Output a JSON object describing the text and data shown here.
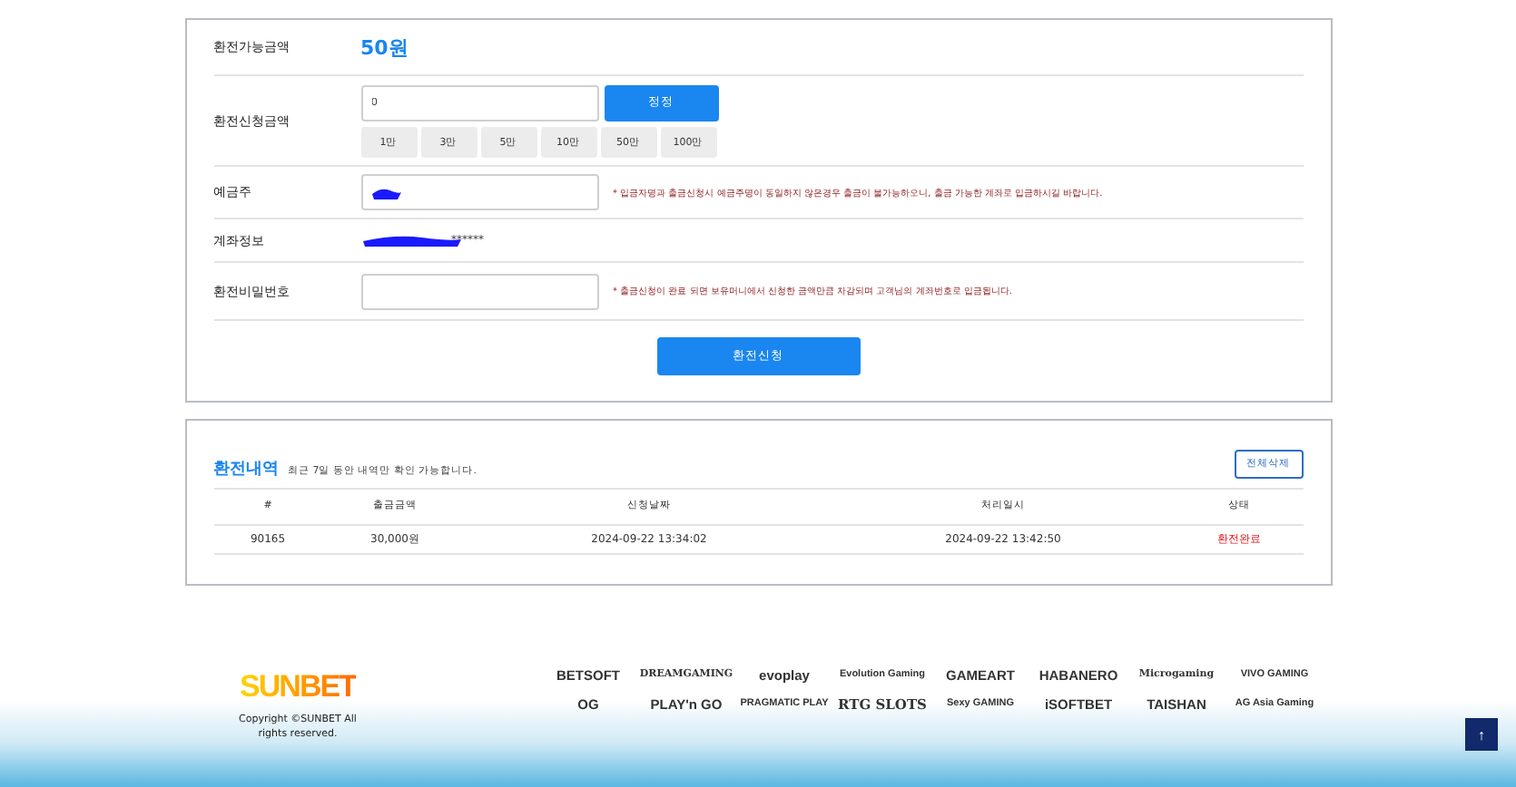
{
  "exchange_form": {
    "available": {
      "label": "환전가능금액",
      "value": "50원"
    },
    "amount": {
      "label": "환전신청금액",
      "value": "0",
      "reset_button": "정정",
      "quick_amounts": [
        "1만",
        "3만",
        "5만",
        "10만",
        "50만",
        "100만"
      ]
    },
    "depositor": {
      "label": "예금주",
      "note": "* 입금자명과 출금신청시 예금주명이 동일하지 않은경우 출금이 불가능하오니, 출금 가능한 계좌로 입금하시길 바랍니다."
    },
    "account": {
      "label": "계좌정보",
      "masked_suffix": "******"
    },
    "password": {
      "label": "환전비밀번호",
      "note": "* 출금신청이 완료 되면 보유머니에서 신청한 금액만큼 차감되며 고객님의 계좌번호로 입금됩니다."
    },
    "submit_button": "환전신청"
  },
  "history": {
    "title": "환전내역",
    "subtitle": "최근 7일 동안 내역만 확인 가능합니다.",
    "delete_button": "전체삭제",
    "columns": [
      "#",
      "출금금액",
      "신청날짜",
      "처리일시",
      "상태"
    ],
    "rows": [
      {
        "cells": [
          "90165",
          "30,000원",
          "2024-09-22 13:34:02",
          "2024-09-22 13:42:50",
          "환전완료"
        ]
      }
    ]
  },
  "footer": {
    "logo": "SUNBET",
    "copyright": "Copyright ©SUNBET All rights reserved.",
    "providers": [
      "BETSOFT",
      "DREAMGAMING",
      "evoplay",
      "Evolution Gaming",
      "GAMEART",
      "HABANERO",
      "Microgaming",
      "VIVO GAMING",
      "OG",
      "PLAY'n GO",
      "PRAGMATIC PLAY",
      "RTG SLOTS",
      "Sexy GAMING",
      "iSOFTBET",
      "TAISHAN",
      "AG Asia Gaming"
    ],
    "scroll_top": "↑"
  }
}
